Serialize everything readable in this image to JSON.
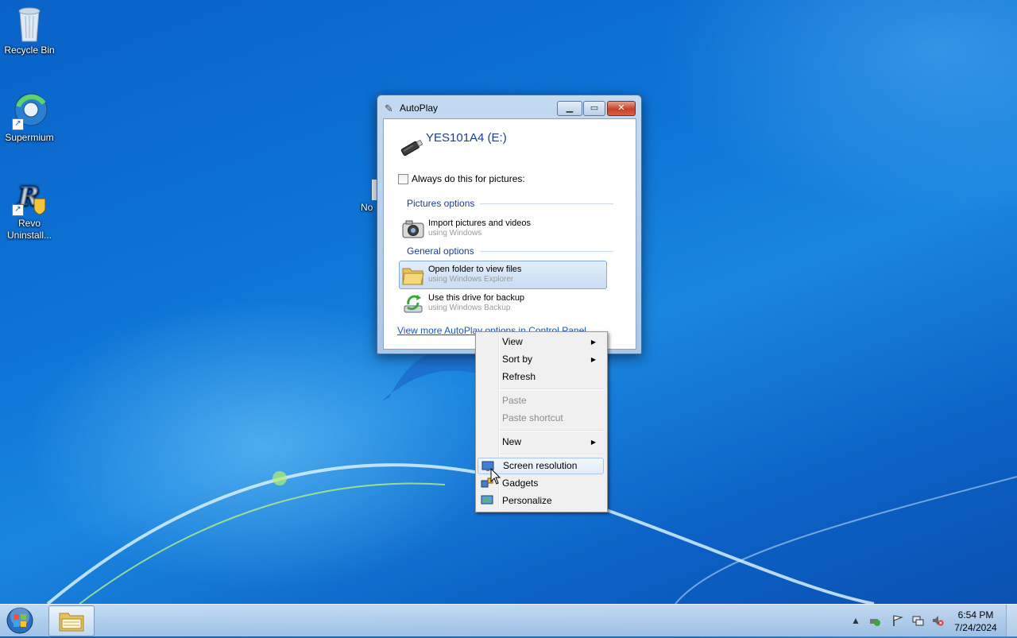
{
  "desktop": {
    "icons": [
      {
        "label": "Recycle Bin",
        "icon": "recycle-bin-icon"
      },
      {
        "label": "Supermium",
        "icon": "supermium-icon"
      },
      {
        "label": "Revo Uninstall...",
        "icon": "revo-uninstaller-icon"
      }
    ],
    "partial_label": "No"
  },
  "autoplay": {
    "title": "AutoPlay",
    "device_name": "YES101A4 (E:)",
    "always_label": "Always do this for pictures:",
    "always_checked": false,
    "pictures_section": "Pictures options",
    "general_section": "General options",
    "options": [
      {
        "title": "Import pictures and videos",
        "subtitle": "using Windows",
        "icon": "camera-icon"
      },
      {
        "title": "Open folder to view files",
        "subtitle": "using Windows Explorer",
        "icon": "folder-icon",
        "selected": true
      },
      {
        "title": "Use this drive for backup",
        "subtitle": "using Windows Backup",
        "icon": "backup-icon"
      }
    ],
    "control_panel_link": "View more AutoPlay options in Control Panel"
  },
  "context_menu": {
    "items": [
      {
        "label": "View",
        "submenu": true
      },
      {
        "label": "Sort by",
        "submenu": true
      },
      {
        "label": "Refresh"
      },
      {
        "label": "Paste",
        "disabled": true
      },
      {
        "label": "Paste shortcut",
        "disabled": true
      },
      {
        "label": "New",
        "submenu": true
      },
      {
        "label": "Screen resolution",
        "icon": "screen-resolution-icon",
        "hover": true
      },
      {
        "label": "Gadgets",
        "icon": "gadgets-icon"
      },
      {
        "label": "Personalize",
        "icon": "personalize-icon"
      }
    ]
  },
  "taskbar": {
    "clock_time": "6:54 PM",
    "clock_date": "7/24/2024"
  },
  "colors": {
    "desktop_blue": "#0d74d6",
    "link_blue": "#1c55b6",
    "heading_blue": "#1e3c8c"
  }
}
